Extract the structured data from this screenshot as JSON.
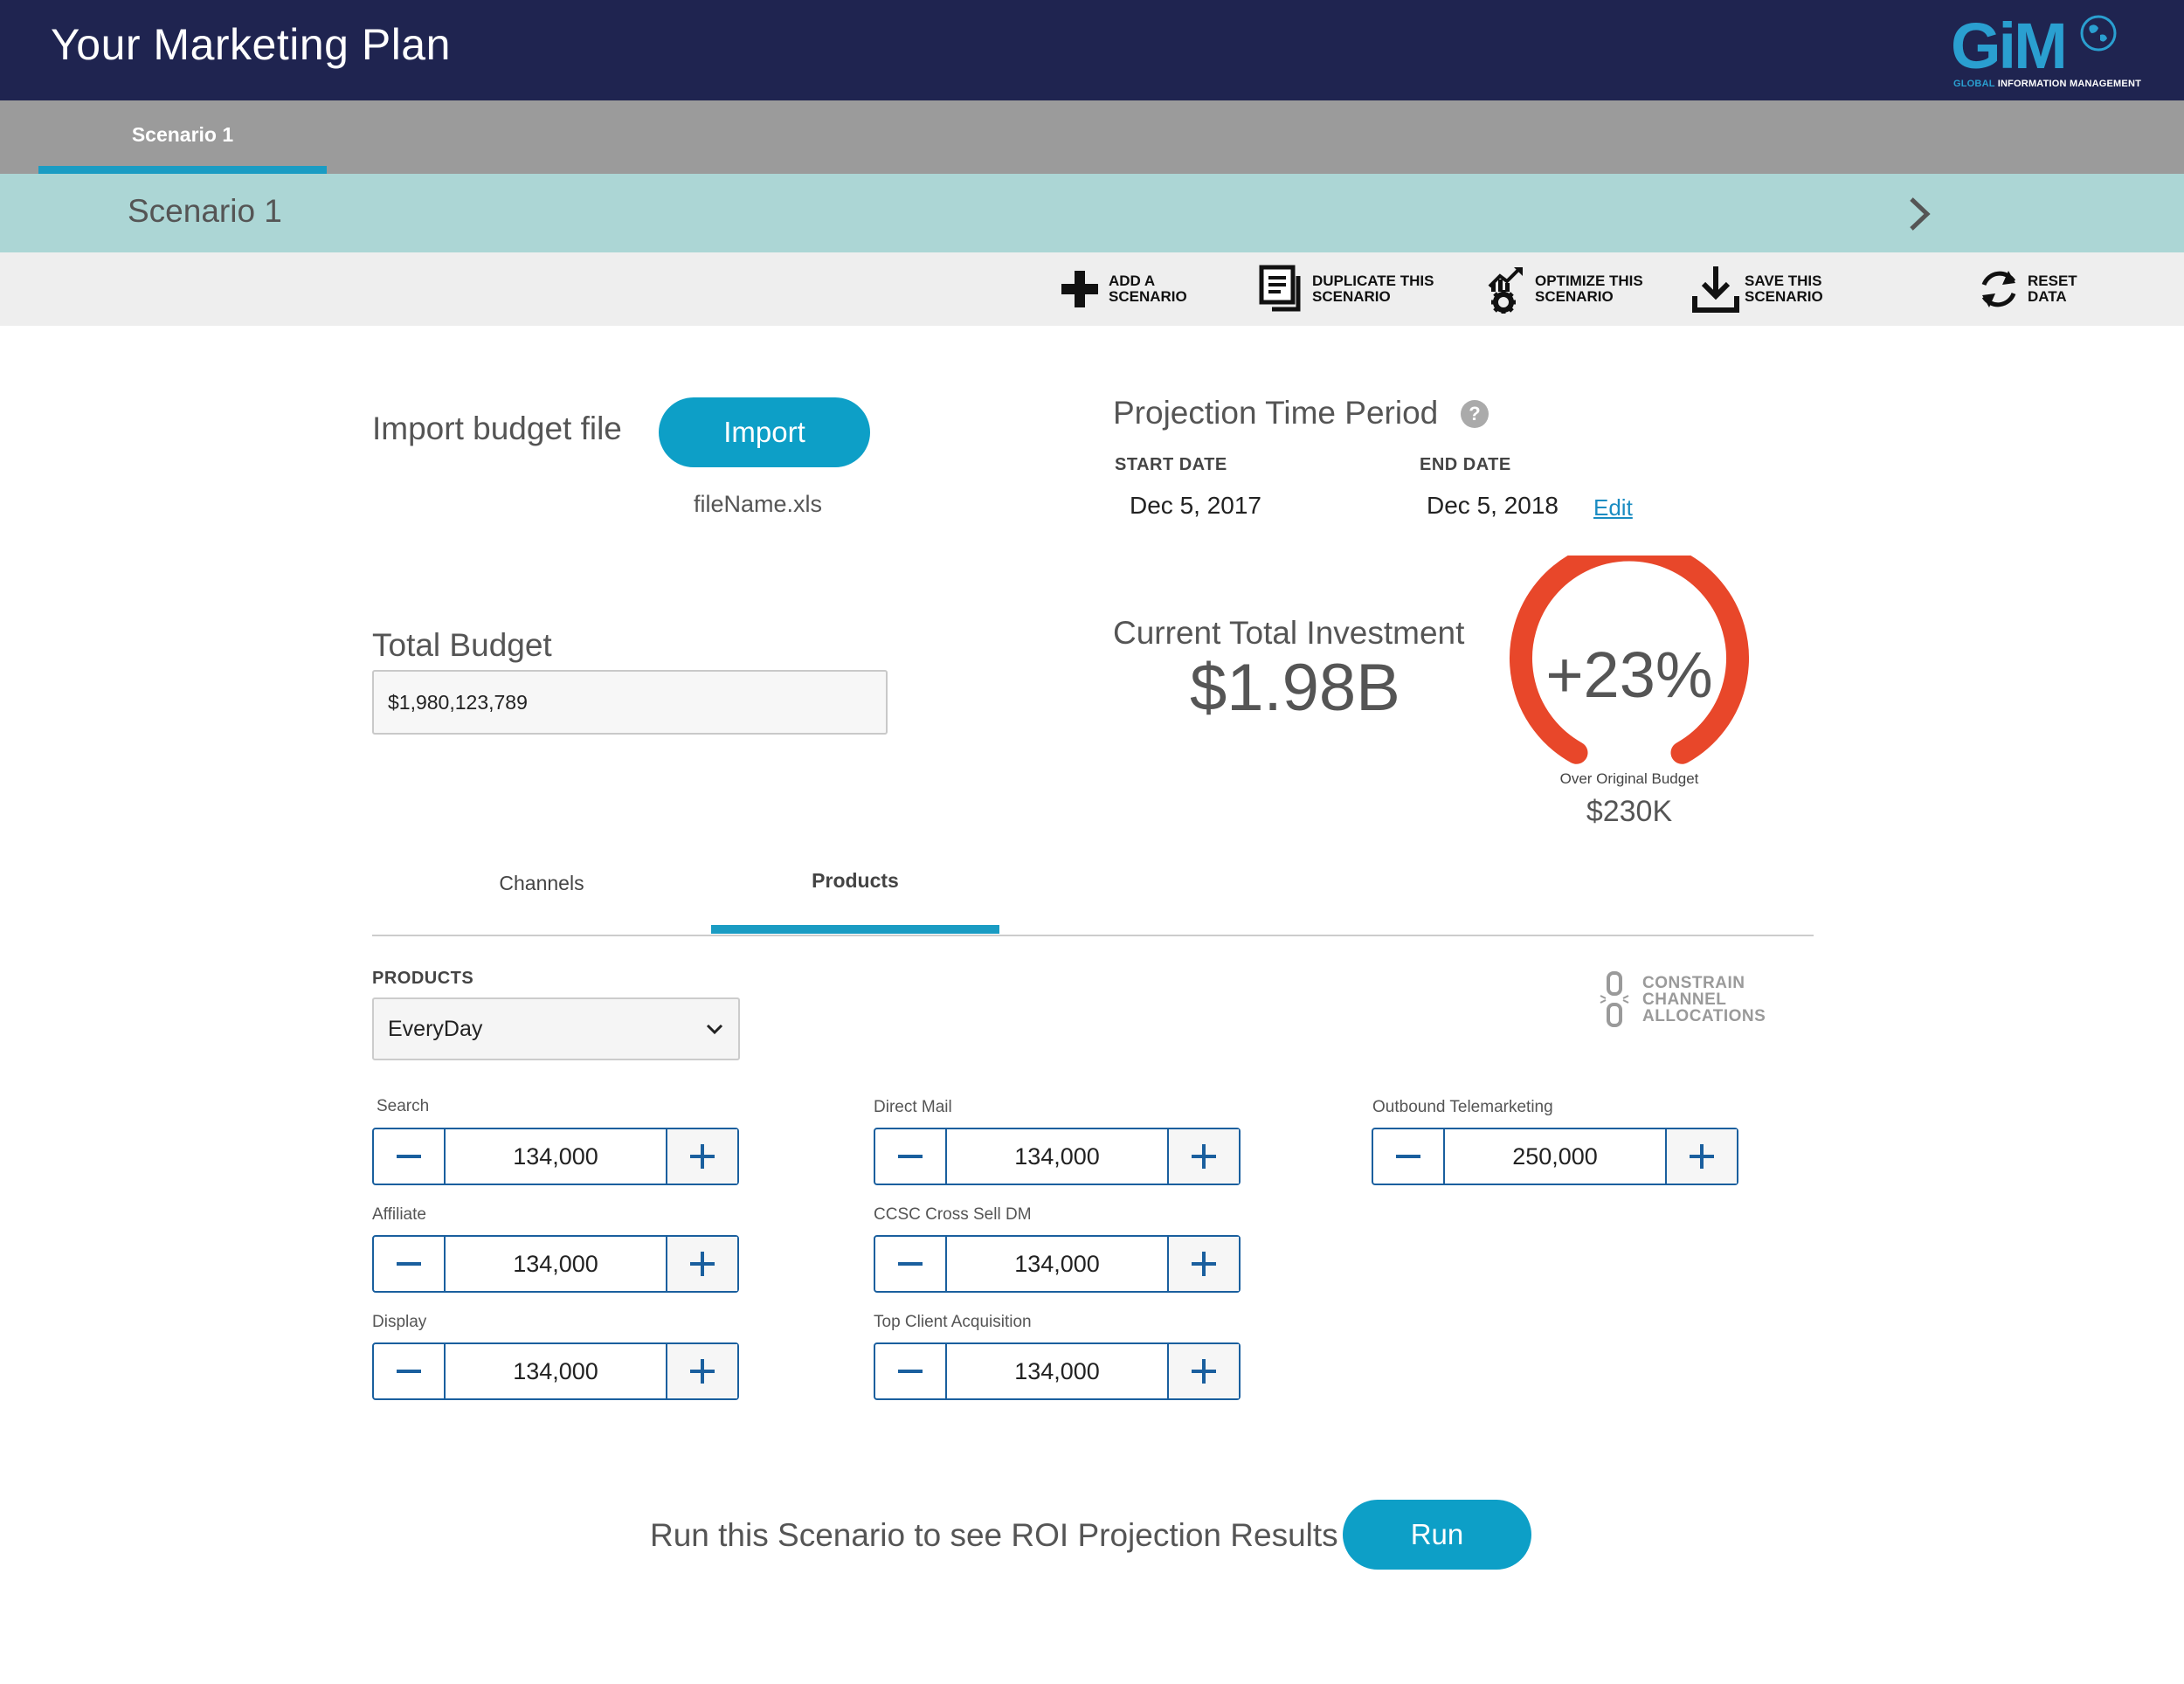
{
  "header": {
    "title": "Your Marketing Plan",
    "logo": {
      "text": "GiM",
      "subtitle_a": "GLOBAL",
      "subtitle_b": "INFORMATION MANAGEMENT"
    }
  },
  "scenario_tabs": [
    {
      "label": "Scenario 1",
      "active": true
    }
  ],
  "scenario_name": "Scenario 1",
  "toolbar": {
    "add": "ADD A SCENARIO",
    "duplicate": "DUPLICATE THIS SCENARIO",
    "optimize": "OPTIMIZE THIS SCENARIO",
    "save": "SAVE THIS SCENARIO",
    "reset": "RESET DATA"
  },
  "import": {
    "label": "Import budget file",
    "button": "Import",
    "filename": "fileName.xls"
  },
  "projection": {
    "title": "Projection Time Period",
    "help": "?",
    "start_label": "START DATE",
    "start_value": "Dec 5, 2017",
    "end_label": "END DATE",
    "end_value": "Dec 5, 2018",
    "edit": "Edit"
  },
  "budget": {
    "label": "Total Budget",
    "value": "$1,980,123,789"
  },
  "investment": {
    "label": "Current Total Investment",
    "value": "$1.98B",
    "gauge_percent": "+23%",
    "gauge_caption": "Over Original Budget",
    "gauge_amount": "$230K"
  },
  "content_tabs": [
    {
      "label": "Channels",
      "active": false
    },
    {
      "label": "Products",
      "active": true
    }
  ],
  "products": {
    "label": "PRODUCTS",
    "selected": "EveryDay",
    "constrain": [
      "CONSTRAIN",
      "CHANNEL",
      "ALLOCATIONS"
    ]
  },
  "steppers": [
    {
      "label": "Search",
      "value": "134,000"
    },
    {
      "label": "Affiliate",
      "value": "134,000"
    },
    {
      "label": "Display",
      "value": "134,000"
    },
    {
      "label": "Direct Mail",
      "value": "134,000"
    },
    {
      "label": "CCSC Cross Sell DM",
      "value": "134,000"
    },
    {
      "label": "Top Client Acquisition",
      "value": "134,000"
    },
    {
      "label": "Outbound Telemarketing",
      "value": "250,000"
    }
  ],
  "run": {
    "text": "Run this Scenario to see ROI Projection Results",
    "button": "Run"
  },
  "colors": {
    "header_bg": "#1f2450",
    "accent": "#0d9fc7",
    "tabbar_bg": "#9b9b9b",
    "namebar_bg": "#acd6d5",
    "gauge": "#e8472a",
    "stepper_border": "#1a5f9e"
  }
}
